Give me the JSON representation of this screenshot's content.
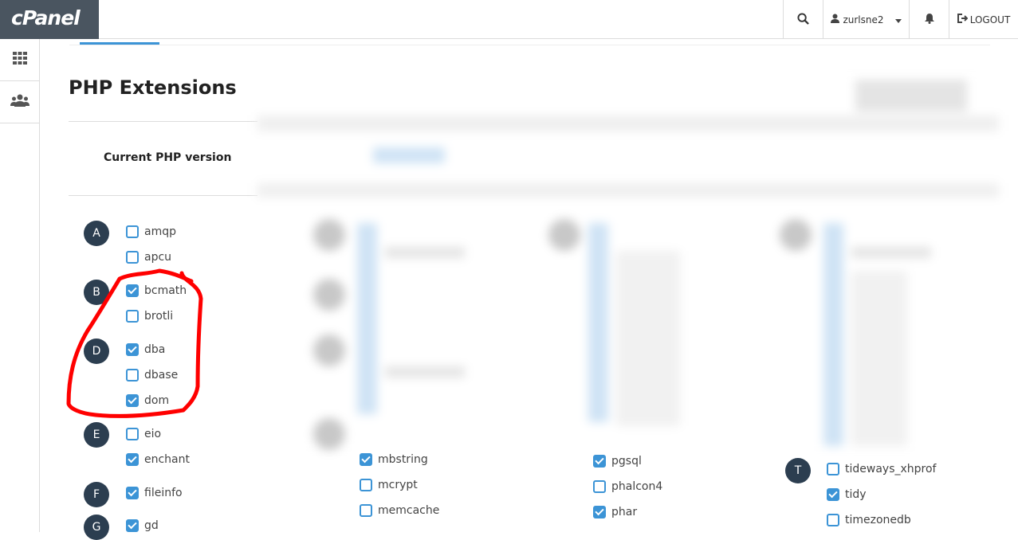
{
  "topbar": {
    "logo_text": "cPanel",
    "username": "zurlsne2",
    "logout_label": "LOGOUT"
  },
  "page": {
    "title": "PHP Extensions",
    "current_version_label": "Current PHP version"
  },
  "column1": {
    "letters": [
      "A",
      "B",
      "D",
      "E",
      "F",
      "G"
    ],
    "items": [
      {
        "name": "amqp",
        "checked": false
      },
      {
        "name": "apcu",
        "checked": false
      },
      {
        "name": "bcmath",
        "checked": true
      },
      {
        "name": "brotli",
        "checked": false
      },
      {
        "name": "dba",
        "checked": true
      },
      {
        "name": "dbase",
        "checked": false
      },
      {
        "name": "dom",
        "checked": true
      },
      {
        "name": "eio",
        "checked": false
      },
      {
        "name": "enchant",
        "checked": true
      },
      {
        "name": "fileinfo",
        "checked": true
      },
      {
        "name": "gd",
        "checked": true
      }
    ]
  },
  "column2": {
    "items": [
      {
        "name": "mbstring",
        "checked": true
      },
      {
        "name": "mcrypt",
        "checked": false
      },
      {
        "name": "memcache",
        "checked": false
      }
    ]
  },
  "column3": {
    "items": [
      {
        "name": "pgsql",
        "checked": true
      },
      {
        "name": "phalcon4",
        "checked": false
      },
      {
        "name": "phar",
        "checked": true
      }
    ]
  },
  "column4": {
    "letters": [
      "T"
    ],
    "items": [
      {
        "name": "tideways_xhprof",
        "checked": false
      },
      {
        "name": "tidy",
        "checked": true
      },
      {
        "name": "timezonedb",
        "checked": false
      }
    ]
  },
  "colors": {
    "accent": "#3c94d6",
    "letter_badge": "#2c3e50",
    "annotation": "#ff0000",
    "logo_bg": "#4a5560"
  }
}
